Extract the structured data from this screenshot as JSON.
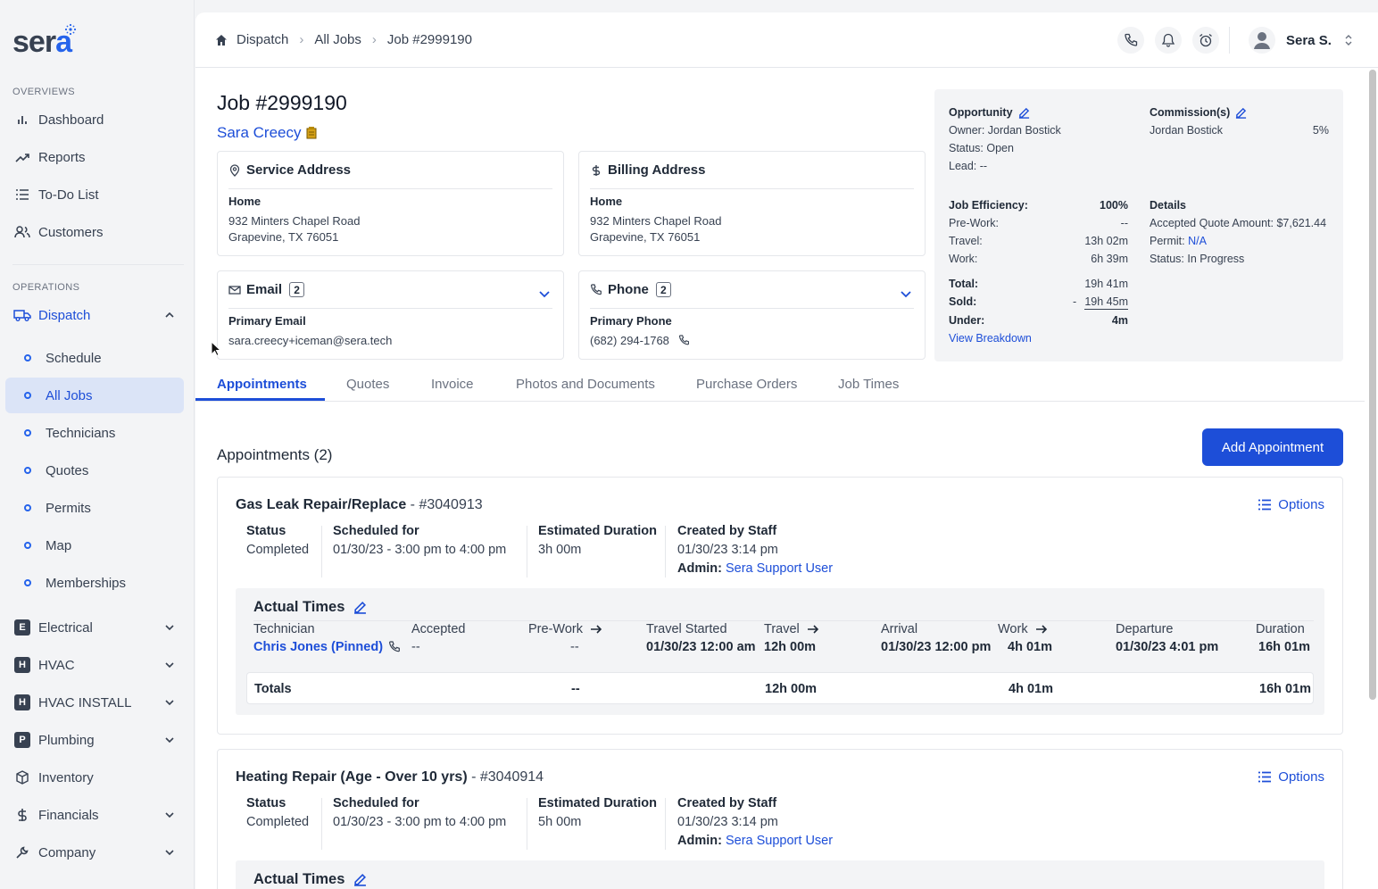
{
  "brand": {
    "logo_main": "ser",
    "logo_accent": "a"
  },
  "sidebar": {
    "overviews_label": "OVERVIEWS",
    "operations_label": "OPERATIONS",
    "overviews": [
      {
        "label": "Dashboard",
        "icon": "bar-chart-icon"
      },
      {
        "label": "Reports",
        "icon": "trend-icon"
      },
      {
        "label": "To-Do List",
        "icon": "list-icon"
      },
      {
        "label": "Customers",
        "icon": "users-icon"
      }
    ],
    "dispatch": {
      "label": "Dispatch",
      "icon": "truck-icon"
    },
    "dispatch_children": [
      "Schedule",
      "All Jobs",
      "Technicians",
      "Quotes",
      "Permits",
      "Map",
      "Memberships"
    ],
    "departments": [
      {
        "letter": "E",
        "label": "Electrical"
      },
      {
        "letter": "H",
        "label": "HVAC"
      },
      {
        "letter": "H",
        "label": "HVAC INSTALL"
      },
      {
        "letter": "P",
        "label": "Plumbing"
      }
    ],
    "bottom": [
      {
        "label": "Inventory",
        "icon": "box-icon"
      },
      {
        "label": "Financials",
        "icon": "dollar-icon"
      },
      {
        "label": "Company",
        "icon": "wrench-icon"
      }
    ]
  },
  "breadcrumb": [
    "Dispatch",
    "All Jobs",
    "Job #2999190"
  ],
  "user": {
    "name": "Sera S."
  },
  "job": {
    "title": "Job #2999190",
    "customer": "Sara Creecy"
  },
  "service_address": {
    "title": "Service Address",
    "label": "Home",
    "line1": "932 Minters Chapel Road",
    "line2": "Grapevine, TX 76051"
  },
  "billing_address": {
    "title": "Billing Address",
    "label": "Home",
    "line1": "932 Minters Chapel Road",
    "line2": "Grapevine, TX 76051"
  },
  "email": {
    "title": "Email",
    "count": "2",
    "label": "Primary Email",
    "value": "sara.creecy+iceman@sera.tech"
  },
  "phone": {
    "title": "Phone",
    "count": "2",
    "label": "Primary Phone",
    "value": "(682) 294-1768"
  },
  "summary": {
    "opportunity_title": "Opportunity",
    "owner": "Owner: Jordan Bostick",
    "status": "Status: Open",
    "lead": "Lead: --",
    "commission_title": "Commission(s)",
    "commission_name": "Jordan Bostick",
    "commission_pct": "5%",
    "efficiency_label": "Job Efficiency:",
    "efficiency_value": "100%",
    "prework_label": "Pre-Work:",
    "prework_value": "--",
    "travel_label": "Travel:",
    "travel_value": "13h 02m",
    "work_label": "Work:",
    "work_value": "6h 39m",
    "total_label": "Total:",
    "total_value": "19h 41m",
    "sold_label": "Sold:",
    "sold_prefix": "-",
    "sold_value": "19h 45m",
    "under_label": "Under:",
    "under_value": "4m",
    "view_breakdown": "View Breakdown",
    "details_title": "Details",
    "accepted_quote": "Accepted Quote Amount: $7,621.44",
    "permit_label": "Permit:",
    "permit_value": "N/A",
    "details_status": "Status: In Progress"
  },
  "tabs": [
    "Appointments",
    "Quotes",
    "Invoice",
    "Photos and Documents",
    "Purchase Orders",
    "Job Times"
  ],
  "appointments_heading": "Appointments (2)",
  "add_appointment": "Add Appointment",
  "options_label": "Options",
  "col_labels": {
    "status": "Status",
    "scheduled": "Scheduled for",
    "duration": "Estimated Duration",
    "created": "Created by Staff",
    "admin": "Admin:"
  },
  "actual_times_label": "Actual Times",
  "at_headers": {
    "technician": "Technician",
    "accepted": "Accepted",
    "prework": "Pre-Work",
    "travel_started": "Travel Started",
    "travel": "Travel",
    "arrival": "Arrival",
    "work": "Work",
    "departure": "Departure",
    "duration": "Duration"
  },
  "appointments": [
    {
      "title": "Gas Leak Repair/Replace",
      "number": "- #3040913",
      "status": "Completed",
      "scheduled": "01/30/23 - 3:00 pm to 4:00 pm",
      "duration": "3h 00m",
      "created": "01/30/23 3:14 pm",
      "admin": "Sera Support User",
      "row": {
        "technician": "Chris Jones (Pinned)",
        "accepted": "--",
        "prework": "--",
        "travel_started": "01/30/23 12:00 am",
        "travel": "12h 00m",
        "arrival": "01/30/23 12:00 pm",
        "work": "4h 01m",
        "departure": "01/30/23 4:01 pm",
        "duration": "16h 01m"
      },
      "totals": {
        "label": "Totals",
        "prework": "--",
        "travel": "12h 00m",
        "work": "4h 01m",
        "duration": "16h 01m"
      }
    },
    {
      "title": "Heating Repair (Age - Over 10 yrs)",
      "number": "- #3040914",
      "status": "Completed",
      "scheduled": "01/30/23 - 3:00 pm to 4:00 pm",
      "duration": "5h 00m",
      "created": "01/30/23 3:14 pm",
      "admin": "Sera Support User"
    }
  ]
}
